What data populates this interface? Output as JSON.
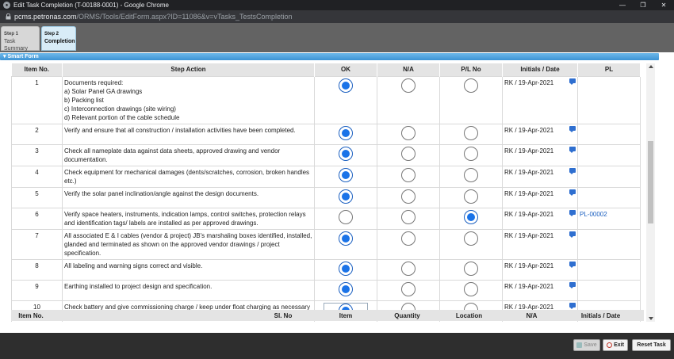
{
  "window": {
    "title": "Edit Task Completion (T-00188-0001) - Google Chrome",
    "url_host": "pcms.petronas.com",
    "url_path": "/ORMS/Tools/EditForm.aspx?ID=11086&v=vTasks_TestsCompletion"
  },
  "steps": [
    {
      "num": "Step 1",
      "name": "Task Summary"
    },
    {
      "num": "Step 2",
      "name": "Completion"
    }
  ],
  "panel": {
    "title": "Smart Form"
  },
  "grid": {
    "columns": [
      "Item No.",
      "Step Action",
      "OK",
      "N/A",
      "P/L No",
      "Initials / Date",
      "PL"
    ],
    "rows": [
      {
        "item": "1",
        "action_lines": [
          "Documents required:",
          "a) Solar Panel GA drawings",
          "b) Packing list",
          "c) Interconnection drawings (site wiring)",
          "d) Relevant portion of the cable schedule"
        ],
        "selected": "ok",
        "initials": "RK / 19-Apr-2021",
        "pl": ""
      },
      {
        "item": "2",
        "action_lines": [
          "Verify and ensure that all construction / installation activities have been completed."
        ],
        "selected": "ok",
        "initials": "RK / 19-Apr-2021",
        "pl": ""
      },
      {
        "item": "3",
        "action_lines": [
          "Check all nameplate data against data sheets, approved drawing and vendor documentation."
        ],
        "selected": "ok",
        "initials": "RK / 19-Apr-2021",
        "pl": ""
      },
      {
        "item": "4",
        "action_lines": [
          "Check equipment for mechanical damages (dents/scratches, corrosion, broken handles etc.)"
        ],
        "selected": "ok",
        "initials": "RK / 19-Apr-2021",
        "pl": ""
      },
      {
        "item": "5",
        "action_lines": [
          "Verify the solar panel inclination/angle against the design documents."
        ],
        "selected": "ok",
        "initials": "RK / 19-Apr-2021",
        "pl": ""
      },
      {
        "item": "6",
        "action_lines": [
          "Verify space heaters, instruments, indication lamps, control switches, protection relays and identification tags/ labels are installed as per approved drawings."
        ],
        "selected": "pl",
        "initials": "RK / 19-Apr-2021",
        "pl": "PL-00002"
      },
      {
        "item": "7",
        "action_lines": [
          "All associated E & I cables (vendor & project) JB's marshaling boxes identified, installed, glanded and terminated as shown on the approved vendor drawings / project specification."
        ],
        "selected": "ok",
        "initials": "RK / 19-Apr-2021",
        "pl": ""
      },
      {
        "item": "8",
        "action_lines": [
          "All labeling and warning signs correct and visible."
        ],
        "selected": "ok",
        "initials": "RK / 19-Apr-2021",
        "pl": ""
      },
      {
        "item": "9",
        "action_lines": [
          "Earthing installed to project design and specification."
        ],
        "selected": "ok",
        "initials": "RK / 19-Apr-2021",
        "pl": ""
      },
      {
        "item": "10",
        "action_lines": [
          "Check battery and give commissioning charge / keep under float charging as necessary"
        ],
        "selected": "ok",
        "initials": "RK / 19-Apr-2021",
        "pl": ""
      }
    ]
  },
  "grid2": {
    "columns": [
      "Item No.",
      "Sl. No",
      "Item",
      "Quantity",
      "Location",
      "N/A",
      "Initials / Date"
    ]
  },
  "footer": {
    "save_label": "Save",
    "exit_label": "Exit",
    "reset_label": "Reset Task"
  },
  "icons": {
    "app": "chrome-icon",
    "lock": "lock-icon",
    "comment": "comment-icon"
  }
}
